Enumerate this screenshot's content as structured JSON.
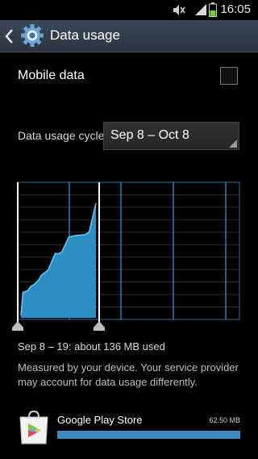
{
  "status_bar": {
    "time": "16:05",
    "icons": [
      "mute-icon",
      "signal-icon",
      "battery-icon"
    ]
  },
  "action_bar": {
    "title": "Data usage",
    "back_icon": "chevron-left-icon",
    "settings_icon": "gear-icon"
  },
  "mobile_data": {
    "label": "Mobile data",
    "checked": false
  },
  "cycle": {
    "label": "Data usage cycle",
    "value": "Sep 8 – Oct 8"
  },
  "chart_data": {
    "type": "area",
    "x_range": [
      "Sep 8",
      "Oct 8"
    ],
    "selected_range": [
      "Sep 8",
      "Sep 19"
    ],
    "y_unit": "MB",
    "ylim": [
      0,
      140
    ],
    "x": [
      0,
      0.3,
      1,
      1.4,
      2,
      2.6,
      3,
      4,
      5,
      5.5,
      6,
      7,
      8,
      9.4,
      10,
      11
    ],
    "y": [
      0,
      28,
      30,
      35,
      38,
      43,
      49,
      55,
      75,
      75,
      77,
      95,
      97,
      98,
      101,
      136
    ],
    "grid": true,
    "accent": "#2f9fd8"
  },
  "summary": "Sep 8 – 19: about 136 MB used",
  "note": "Measured by your device. Your service provider may account for data usage differently.",
  "apps": [
    {
      "name": "Google Play Store",
      "size": "62.50 MB",
      "share": 1.0,
      "icon": "play-store-icon",
      "bar_color": "#3d8bbd"
    }
  ]
}
